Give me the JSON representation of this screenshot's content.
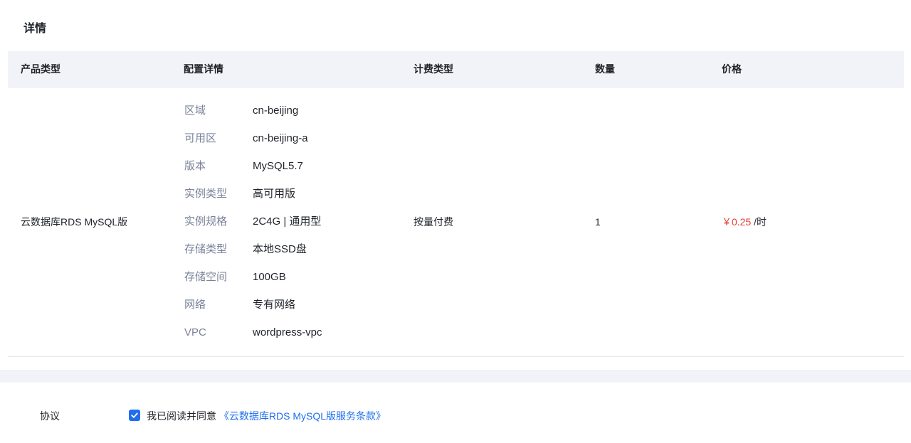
{
  "section": {
    "title": "详情"
  },
  "table": {
    "headers": {
      "product_type": "产品类型",
      "config": "配置详情",
      "billing": "计费类型",
      "quantity": "数量",
      "price": "价格"
    },
    "row": {
      "product": "云数据库RDS MySQL版",
      "billing": "按量付费",
      "quantity": "1",
      "price_amount": "￥0.25",
      "price_unit": "/时",
      "config": [
        {
          "key": "区域",
          "value": "cn-beijing"
        },
        {
          "key": "可用区",
          "value": "cn-beijing-a"
        },
        {
          "key": "版本",
          "value": "MySQL5.7"
        },
        {
          "key": "实例类型",
          "value": "高可用版"
        },
        {
          "key": "实例规格",
          "value": "2C4G | 通用型"
        },
        {
          "key": "存储类型",
          "value": "本地SSD盘"
        },
        {
          "key": "存储空间",
          "value": "100GB"
        },
        {
          "key": "网络",
          "value": "专有网络"
        },
        {
          "key": "VPC",
          "value": "wordpress-vpc"
        }
      ]
    }
  },
  "agreement": {
    "label": "协议",
    "checked": true,
    "text": "我已阅读并同意",
    "link": "《云数据库RDS MySQL版服务条款》"
  },
  "colors": {
    "accent": "#1f6feb",
    "price": "#e63e32",
    "header_bg": "#f2f3f8"
  }
}
